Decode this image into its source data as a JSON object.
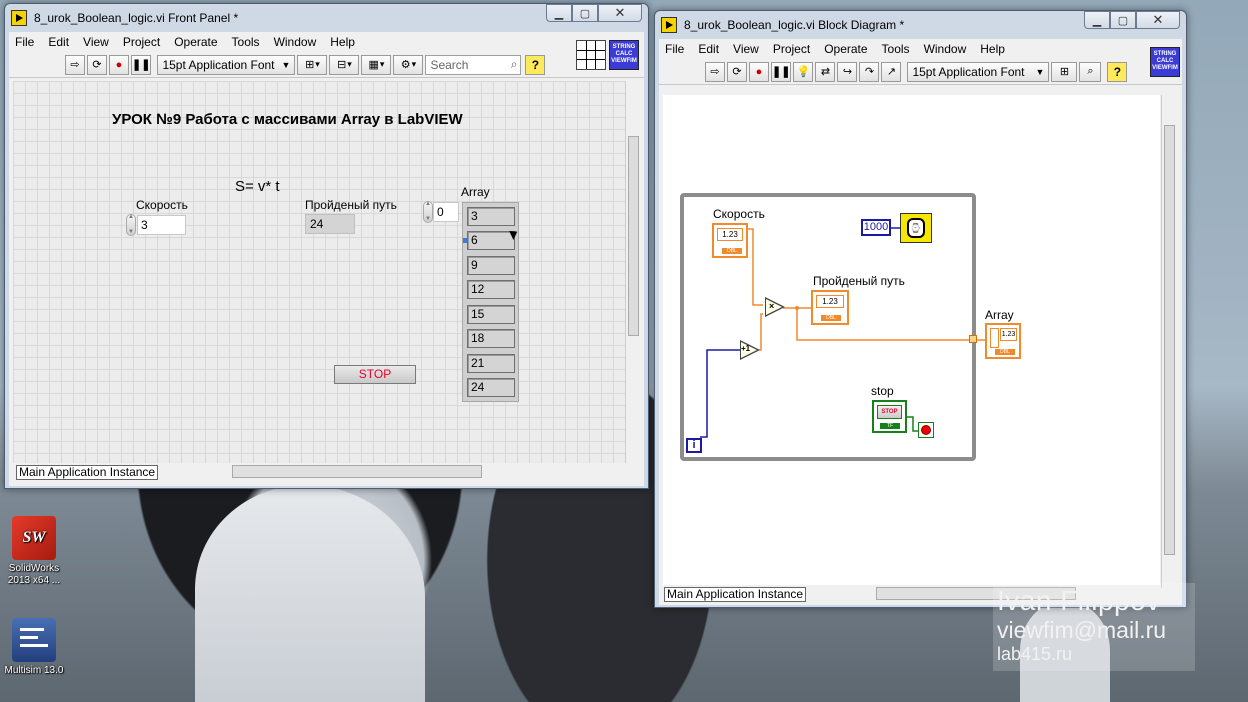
{
  "front_panel": {
    "title": "8_urok_Boolean_logic.vi Front Panel *",
    "menu": [
      "File",
      "Edit",
      "View",
      "Project",
      "Operate",
      "Tools",
      "Window",
      "Help"
    ],
    "font": "15pt Application Font",
    "search_placeholder": "Search",
    "help": "?",
    "vi_icon": [
      "STRING",
      "CALC",
      "VIEWFIM"
    ],
    "heading": "УРОК №9 Работа с массивами Array в LabVIEW",
    "formula": "S= v* t",
    "speed_label": "Скорость",
    "speed_value": "3",
    "distance_label": "Пройденый путь",
    "distance_value": "24",
    "array_label": "Array",
    "array_index": "0",
    "array_values": [
      "3",
      "6",
      "9",
      "12",
      "15",
      "18",
      "21",
      "24"
    ],
    "stop_label": "STOP",
    "instance": "Main Application Instance"
  },
  "block_diagram": {
    "title": "8_urok_Boolean_logic.vi Block Diagram *",
    "menu": [
      "File",
      "Edit",
      "View",
      "Project",
      "Operate",
      "Tools",
      "Window",
      "Help"
    ],
    "font": "15pt Application Font",
    "help": "?",
    "vi_icon": [
      "STRING",
      "CALC",
      "VIEWFIM"
    ],
    "speed_label": "Скорость",
    "distance_label": "Пройденый путь",
    "array_label": "Array",
    "stop_label": "stop",
    "wait_constant": "1000",
    "iteration": "i",
    "numeric_tag": "1.23",
    "dbl_tag": "DBL",
    "tf_tag": "TF",
    "stop_btn_text": "STOP",
    "multiply_glyph": "×",
    "increment_glyph": "+1",
    "instance": "Main Application Instance"
  },
  "desktop": {
    "icons": [
      {
        "label": "SolidWorks 2013 x64 ...",
        "glyph": "SW"
      },
      {
        "label": "Multisim 13.0"
      }
    ]
  },
  "watermark": {
    "name": "Ivan Filippov",
    "email": "viewfim@mail.ru",
    "site": "lab415.ru"
  },
  "colors": {
    "wire_numeric": "#f08a2c",
    "wire_int": "#1a1aa6",
    "wire_bool": "#16801a",
    "stop_text": "#e8002c"
  }
}
